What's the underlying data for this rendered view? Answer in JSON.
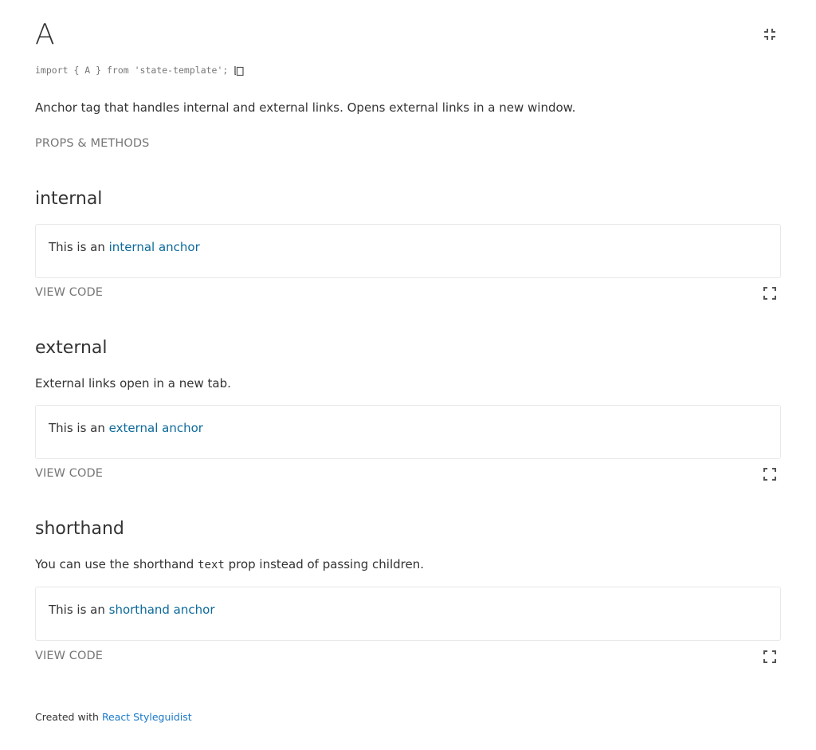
{
  "component": {
    "title": "A",
    "import_statement": "import { A } from 'state-template';",
    "description": "Anchor tag that handles internal and external links. Opens external links in a new window.",
    "props_link": "PROPS & METHODS"
  },
  "icons": {
    "isolate": "collapse-icon",
    "copy": "copy-icon",
    "fullscreen": "fullscreen-icon"
  },
  "sections": [
    {
      "title": "internal",
      "description": "",
      "preview_prefix": "This is an ",
      "preview_link": "internal anchor",
      "view_code": "VIEW CODE"
    },
    {
      "title": "external",
      "description": "External links open in a new tab.",
      "preview_prefix": "This is an ",
      "preview_link": "external anchor",
      "view_code": "VIEW CODE"
    },
    {
      "title": "shorthand",
      "description_before": "You can use the shorthand ",
      "description_code": "text",
      "description_after": " prop instead of passing children.",
      "preview_prefix": "This is an ",
      "preview_link": "shorthand anchor",
      "view_code": "VIEW CODE"
    }
  ],
  "footer": {
    "prefix": "Created with ",
    "link": "React Styleguidist"
  },
  "colors": {
    "text": "#333333",
    "muted": "#767676",
    "link": "#1978c8",
    "preview_link": "#0d6a9b",
    "border": "#e8e8e8"
  }
}
